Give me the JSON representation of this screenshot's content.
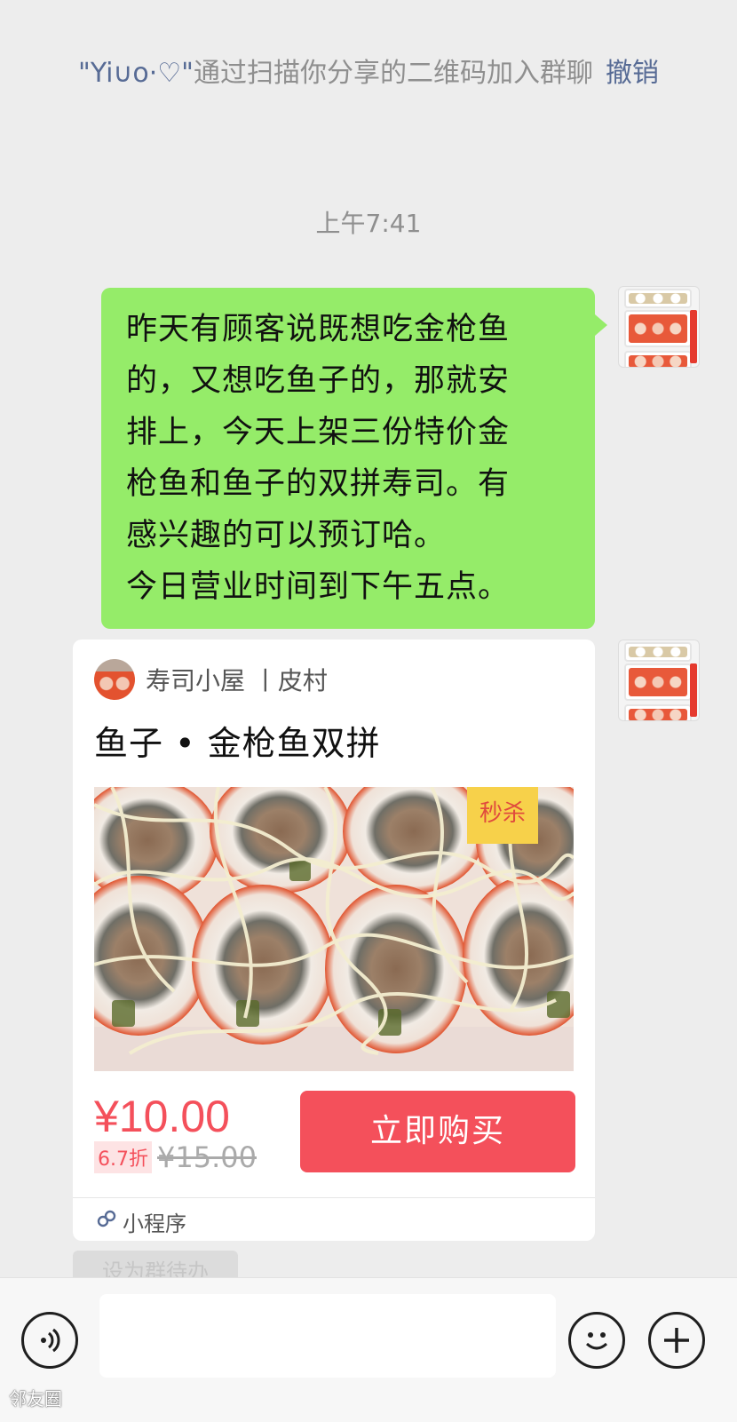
{
  "system_notice": {
    "nickname": "\"Yi∪o·♡\"",
    "text": "通过扫描你分享的二维码加入群聊",
    "revoke_label": "撤销"
  },
  "timestamp": "上午7:41",
  "message": {
    "lines": [
      "昨天有顾客说既想吃金枪鱼",
      "的，又想吃鱼子的，那就安",
      "排上，今天上架三份特价金",
      "枪鱼和鱼子的双拼寿司。有",
      "感兴趣的可以预订哈。",
      "今日营业时间到下午五点。"
    ]
  },
  "mini_program_card": {
    "shop_name": "寿司小屋 丨皮村",
    "title": "鱼子 • 金枪鱼双拼",
    "badge": "秒杀",
    "price": "¥10.00",
    "discount": "6.7折",
    "original_price": "¥15.00",
    "buy_label": "立即购买",
    "footer_label": "小程序",
    "footer_icon": "mini-program-icon"
  },
  "todo_label": "设为群待办",
  "input_bar": {
    "voice_icon": "voice-icon",
    "emoji_icon": "emoji-icon",
    "plus_icon": "plus-icon"
  },
  "watermark": "邻友圈",
  "colors": {
    "bubble": "#95ec69",
    "accent": "#f4505b",
    "link": "#576b95",
    "background": "#ededed"
  }
}
